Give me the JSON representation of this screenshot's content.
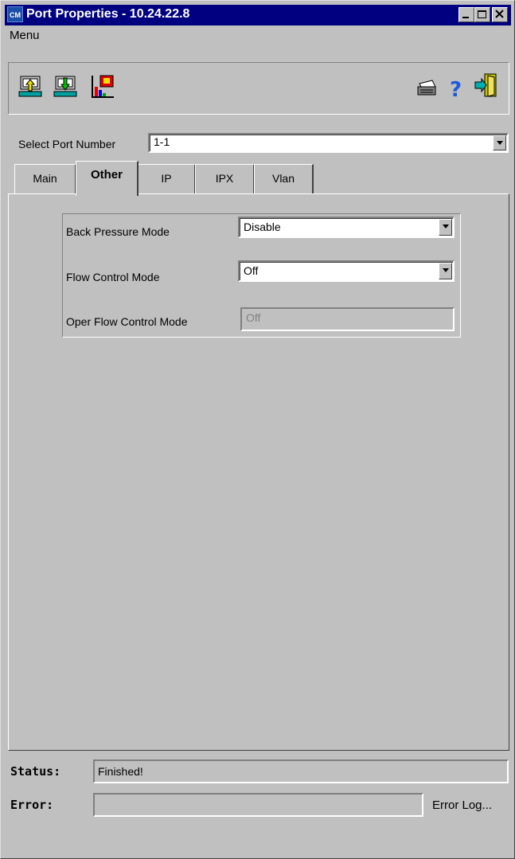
{
  "window": {
    "app_icon_text": "CM",
    "title": "Port Properties - 10.24.22.8"
  },
  "menu": {
    "label": "Menu"
  },
  "toolbar": {
    "left_icons": [
      "upload-config-icon",
      "download-config-icon",
      "chart-statistics-icon"
    ],
    "right_icons": [
      "printer-icon",
      "help-icon",
      "exit-door-icon"
    ],
    "help_glyph": "?"
  },
  "port": {
    "label": "Select Port Number",
    "value": "1-1"
  },
  "tabs": [
    {
      "label": "Main"
    },
    {
      "label": "Other",
      "active": true
    },
    {
      "label": "IP"
    },
    {
      "label": "IPX"
    },
    {
      "label": "Vlan"
    }
  ],
  "settings": {
    "back_pressure": {
      "label": "Back Pressure Mode",
      "value": "Disable"
    },
    "flow_control": {
      "label": "Flow Control Mode",
      "value": "Off"
    },
    "oper_flow_control": {
      "label": "Oper Flow Control Mode",
      "value": "Off"
    }
  },
  "status": {
    "label": "Status:",
    "value": "Finished!",
    "error_label": "Error:",
    "error_value": "",
    "error_log_label": "Error Log..."
  },
  "colors": {
    "title_bar": "#000080",
    "window_bg": "#c0c0c0",
    "help_icon": "#1e5adc"
  }
}
